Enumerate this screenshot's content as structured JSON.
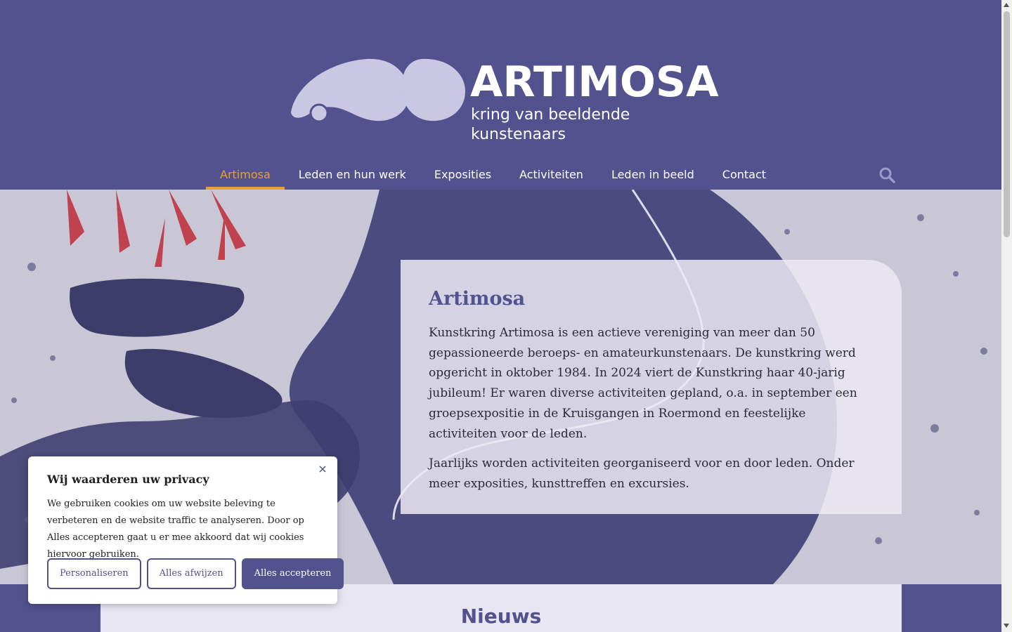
{
  "colors": {
    "brand": "#52528f",
    "accent": "#e9a02f",
    "logo_shape": "#c9c7e2"
  },
  "logo": {
    "word": "ARTIMOSA",
    "subtitle": "kring van beeldende kunstenaars"
  },
  "nav": {
    "items": [
      {
        "label": "Artimosa",
        "active": true
      },
      {
        "label": "Leden en hun werk"
      },
      {
        "label": "Exposities"
      },
      {
        "label": "Activiteiten"
      },
      {
        "label": "Leden in beeld"
      },
      {
        "label": "Contact"
      }
    ],
    "search_icon": "search-icon"
  },
  "intro": {
    "title": "Artimosa",
    "paragraph1": "Kunstkring Artimosa is een actieve vereniging van meer dan 50 gepassioneerde beroeps- en amateurkunstenaars. De kunstkring werd opgericht in oktober 1984. In 2024 viert de Kunstkring haar 40-jarig jubileum! Er waren diverse activiteiten gepland, o.a. in september een groepsexpositie in de Kruisgangen in Roermond en feestelijke activiteiten voor de leden.",
    "paragraph2": "Jaarlijks worden activiteiten georganiseerd voor en door leden. Onder meer exposities, kunsttreffen en excursies."
  },
  "news": {
    "title": "Nieuws"
  },
  "cookie": {
    "title": "Wij waarderen uw privacy",
    "text": "We gebruiken cookies om uw website beleving te verbeteren en de website traffic te analyseren. Door op Alles accepteren gaat u er mee akkoord dat wij cookies hiervoor gebruiken.",
    "buttons": {
      "customize": "Personaliseren",
      "reject": "Alles afwijzen",
      "accept": "Alles accepteren"
    },
    "close_icon": "close-icon"
  }
}
